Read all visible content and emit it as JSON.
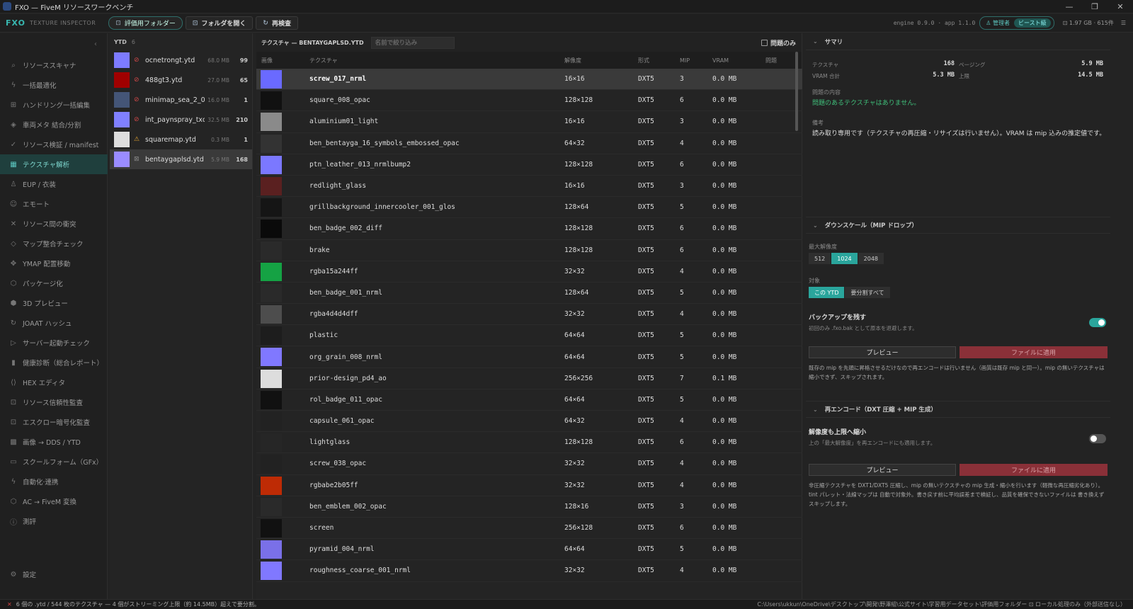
{
  "window": {
    "title": "FXO — FiveM リソースワークベンチ",
    "min": "—",
    "max": "❐",
    "close": "✕"
  },
  "toolbar": {
    "brand": "FXO",
    "brand_sub": "TEXTURE INSPECTOR",
    "eval_folder": "評価用フォルダー",
    "open_folder": "フォルダを開く",
    "rescan": "再検査",
    "engine": "engine 0.9.0 · app 1.1.0",
    "mode": "管理者",
    "mode_tag": "ビースト級",
    "memory": "1.97 GB · 615件"
  },
  "sidebar": {
    "items": [
      {
        "icon": "⌕",
        "label": "リソーススキャナ",
        "name": "resource-scanner"
      },
      {
        "icon": "ϟ",
        "label": "一括最適化",
        "name": "bulk-optimize"
      },
      {
        "icon": "⊞",
        "label": "ハンドリング一括編集",
        "name": "handling-bulk-edit"
      },
      {
        "icon": "◈",
        "label": "車両メタ 結合/分割",
        "name": "vehicle-meta"
      },
      {
        "icon": "✓",
        "label": "リソース検証 / manifest",
        "name": "resource-validate"
      },
      {
        "icon": "▦",
        "label": "テクスチャ解析",
        "name": "texture-analysis"
      },
      {
        "icon": "♙",
        "label": "EUP / 衣装",
        "name": "eup"
      },
      {
        "icon": "☺",
        "label": "エモート",
        "name": "emote"
      },
      {
        "icon": "✕",
        "label": "リソース間の衝突",
        "name": "resource-conflict"
      },
      {
        "icon": "◇",
        "label": "マップ整合チェック",
        "name": "map-check"
      },
      {
        "icon": "✥",
        "label": "YMAP 配置移動",
        "name": "ymap-move"
      },
      {
        "icon": "⬡",
        "label": "パッケージ化",
        "name": "package"
      },
      {
        "icon": "⬢",
        "label": "3D プレビュー",
        "name": "preview-3d"
      },
      {
        "icon": "↻",
        "label": "JOAAT ハッシュ",
        "name": "joaat-hash"
      },
      {
        "icon": "▷",
        "label": "サーバー起動チェック",
        "name": "server-check"
      },
      {
        "icon": "▮",
        "label": "健康診断（総合レポート）",
        "name": "health-report"
      },
      {
        "icon": "⟨⟩",
        "label": "HEX エディタ",
        "name": "hex-editor"
      },
      {
        "icon": "⊡",
        "label": "リソース信頼性監査",
        "name": "trust-audit"
      },
      {
        "icon": "⊡",
        "label": "エスクロー暗号化監査",
        "name": "escrow-audit"
      },
      {
        "icon": "▩",
        "label": "画像 → DDS / YTD",
        "name": "image-dds"
      },
      {
        "icon": "▭",
        "label": "スクールフォーム（GFx）",
        "name": "scaleform"
      },
      {
        "icon": "ϟ",
        "label": "自動化·連携",
        "name": "automation"
      },
      {
        "icon": "⬡",
        "label": "AC → FiveM 変換",
        "name": "ac-convert"
      },
      {
        "icon": "ⓘ",
        "label": "測評",
        "name": "about"
      }
    ],
    "settings": {
      "icon": "⚙",
      "label": "設定"
    }
  },
  "ytd": {
    "header": "YTD",
    "count": "6",
    "items": [
      {
        "name": "ocnetrongt.ytd",
        "size": "68.0 MB",
        "count": "99",
        "status": "⊘",
        "thumb": "#7d7bff"
      },
      {
        "name": "488gt3.ytd",
        "size": "27.0 MB",
        "count": "65",
        "status": "⊘",
        "thumb": "#a00000"
      },
      {
        "name": "minimap_sea_2_0....",
        "size": "16.0 MB",
        "count": "1",
        "status": "⊘",
        "thumb": "#445577"
      },
      {
        "name": "int_paynspray_txd...",
        "size": "32.5 MB",
        "count": "210",
        "status": "⊘",
        "thumb": "#8080ff"
      },
      {
        "name": "squaremap.ytd",
        "size": "0.3 MB",
        "count": "1",
        "status": "⚠",
        "thumb": "#dddddd"
      },
      {
        "name": "bentaygaplsd.ytd",
        "size": "5.9 MB",
        "count": "168",
        "status": "⊠",
        "thumb": "#9a8cff"
      }
    ]
  },
  "textures": {
    "header": "テクスチャ — BENTAYGAPLSD.YTD",
    "filter_placeholder": "名前で絞り込み",
    "only_problems": "問題のみ",
    "columns": {
      "image": "画像",
      "texture": "テクスチャ",
      "resolution": "解像度",
      "format": "形式",
      "mip": "MIP",
      "vram": "VRAM",
      "problem": "問題"
    },
    "rows": [
      {
        "name": "screw_017_nrml",
        "res": "16×16",
        "fmt": "DXT5",
        "mip": "3",
        "vram": "0.0 MB",
        "thumb": "#6a6aff"
      },
      {
        "name": "square_008_opac",
        "res": "128×128",
        "fmt": "DXT5",
        "mip": "6",
        "vram": "0.0 MB",
        "thumb": "#111111"
      },
      {
        "name": "aluminium01_light",
        "res": "16×16",
        "fmt": "DXT5",
        "mip": "3",
        "vram": "0.0 MB",
        "thumb": "#8a8a8a"
      },
      {
        "name": "ben_bentayga_16_symbols_embossed_opac",
        "res": "64×32",
        "fmt": "DXT5",
        "mip": "4",
        "vram": "0.0 MB",
        "thumb": "#333333"
      },
      {
        "name": "ptn_leather_013_nrmlbump2",
        "res": "128×128",
        "fmt": "DXT5",
        "mip": "6",
        "vram": "0.0 MB",
        "thumb": "#7b78ff"
      },
      {
        "name": "redlight_glass",
        "res": "16×16",
        "fmt": "DXT5",
        "mip": "3",
        "vram": "0.0 MB",
        "thumb": "#5a2020"
      },
      {
        "name": "grillbackground_innercooler_001_glos",
        "res": "128×64",
        "fmt": "DXT5",
        "mip": "5",
        "vram": "0.0 MB",
        "thumb": "#151515"
      },
      {
        "name": "ben_badge_002_diff",
        "res": "128×128",
        "fmt": "DXT5",
        "mip": "6",
        "vram": "0.0 MB",
        "thumb": "#0a0a0a"
      },
      {
        "name": "brake",
        "res": "128×128",
        "fmt": "DXT5",
        "mip": "6",
        "vram": "0.0 MB",
        "thumb": "#2a2a2a"
      },
      {
        "name": "rgba15a244ff",
        "res": "32×32",
        "fmt": "DXT5",
        "mip": "4",
        "vram": "0.0 MB",
        "thumb": "#15a244"
      },
      {
        "name": "ben_badge_001_nrml",
        "res": "128×64",
        "fmt": "DXT5",
        "mip": "5",
        "vram": "0.0 MB",
        "thumb": "#2a2a2a"
      },
      {
        "name": "rgba4d4d4dff",
        "res": "32×32",
        "fmt": "DXT5",
        "mip": "4",
        "vram": "0.0 MB",
        "thumb": "#4d4d4d"
      },
      {
        "name": "plastic",
        "res": "64×64",
        "fmt": "DXT5",
        "mip": "5",
        "vram": "0.0 MB",
        "thumb": "#1d1d1d"
      },
      {
        "name": "org_grain_008_nrml",
        "res": "64×64",
        "fmt": "DXT5",
        "mip": "5",
        "vram": "0.0 MB",
        "thumb": "#8078ff"
      },
      {
        "name": "prior-design_pd4_ao",
        "res": "256×256",
        "fmt": "DXT5",
        "mip": "7",
        "vram": "0.1 MB",
        "thumb": "#dddddd"
      },
      {
        "name": "rol_badge_011_opac",
        "res": "64×64",
        "fmt": "DXT5",
        "mip": "5",
        "vram": "0.0 MB",
        "thumb": "#111111"
      },
      {
        "name": "capsule_061_opac",
        "res": "64×32",
        "fmt": "DXT5",
        "mip": "4",
        "vram": "0.0 MB",
        "thumb": "#222222"
      },
      {
        "name": "lightglass",
        "res": "128×128",
        "fmt": "DXT5",
        "mip": "6",
        "vram": "0.0 MB",
        "thumb": "#262626"
      },
      {
        "name": "screw_038_opac",
        "res": "32×32",
        "fmt": "DXT5",
        "mip": "4",
        "vram": "0.0 MB",
        "thumb": "#222222"
      },
      {
        "name": "rgbabe2b05ff",
        "res": "32×32",
        "fmt": "DXT5",
        "mip": "4",
        "vram": "0.0 MB",
        "thumb": "#be2b05"
      },
      {
        "name": "ben_emblem_002_opac",
        "res": "128×16",
        "fmt": "DXT5",
        "mip": "3",
        "vram": "0.0 MB",
        "thumb": "#2a2a2a"
      },
      {
        "name": "screen",
        "res": "256×128",
        "fmt": "DXT5",
        "mip": "6",
        "vram": "0.0 MB",
        "thumb": "#111111"
      },
      {
        "name": "pyramid_004_nrml",
        "res": "64×64",
        "fmt": "DXT5",
        "mip": "5",
        "vram": "0.0 MB",
        "thumb": "#7a70e8"
      },
      {
        "name": "roughness_coarse_001_nrml",
        "res": "32×32",
        "fmt": "DXT5",
        "mip": "4",
        "vram": "0.0 MB",
        "thumb": "#8078ff"
      }
    ]
  },
  "summary": {
    "title": "サマリ",
    "tex_label": "テクスチャ",
    "tex_val": "168",
    "page_label": "ページング",
    "page_val": "5.9 MB",
    "vram_label": "VRAM 合計",
    "vram_val": "5.3 MB",
    "limit_label": "上限",
    "limit_val": "14.5 MB",
    "issues_label": "問題の内容",
    "issues_text": "問題のあるテクスチャはありません。",
    "notes_label": "備考",
    "notes_text": "読み取り専用です（テクスチャの再圧縮・リサイズは行いません）。VRAM は mip 込みの推定値です。"
  },
  "downscale": {
    "title": "ダウンスケール（MIP ドロップ）",
    "max_res_label": "最大解像度",
    "res_options": [
      "512",
      "1024",
      "2048"
    ],
    "target_label": "対象",
    "target_options": [
      "この YTD",
      "要分割すべて"
    ],
    "backup_label": "バックアップを残す",
    "backup_sub": "初回のみ .fxo.bak として原本を退避します。",
    "preview": "プレビュー",
    "apply": "ファイルに適用",
    "desc": "既存の mip を先頭に昇格させるだけなので再エンコードは行いません（画質は既存 mip と同一）。mip の無いテクスチャは縮小できず、スキップされます。"
  },
  "reencode": {
    "title": "再エンコード（DXT 圧縮 + MIP 生成）",
    "shrink_label": "解像度も上限へ縮小",
    "shrink_sub": "上の「最大解像度」を再エンコードにも適用します。",
    "preview": "プレビュー",
    "apply": "ファイルに適用",
    "desc": "非圧縮テクスチャを DXT1/DXT5 圧縮し、mip の無いテクスチャの mip 生成・縮小を行います（軽微な再圧縮劣化あり）。tint パレット・法線マップは 自動で対象外。書き戻す前に平均誤差まで検証し、品質を確保できないファイルは 書き換えずスキップします。"
  },
  "status": {
    "icon": "✕",
    "text": "6 個の .ytd / 544 枚のテクスチャ — 4 個がストリーミング上限（約 14.5MB）超えで要分割。",
    "path": "C:\\Users\\ukkun\\OneDrive\\デスクトップ\\開発\\野澤組\\公式サイト\\学習用データセット\\評価用フォルダー  ⊡ ローカル処理のみ（外部送信なし）"
  }
}
